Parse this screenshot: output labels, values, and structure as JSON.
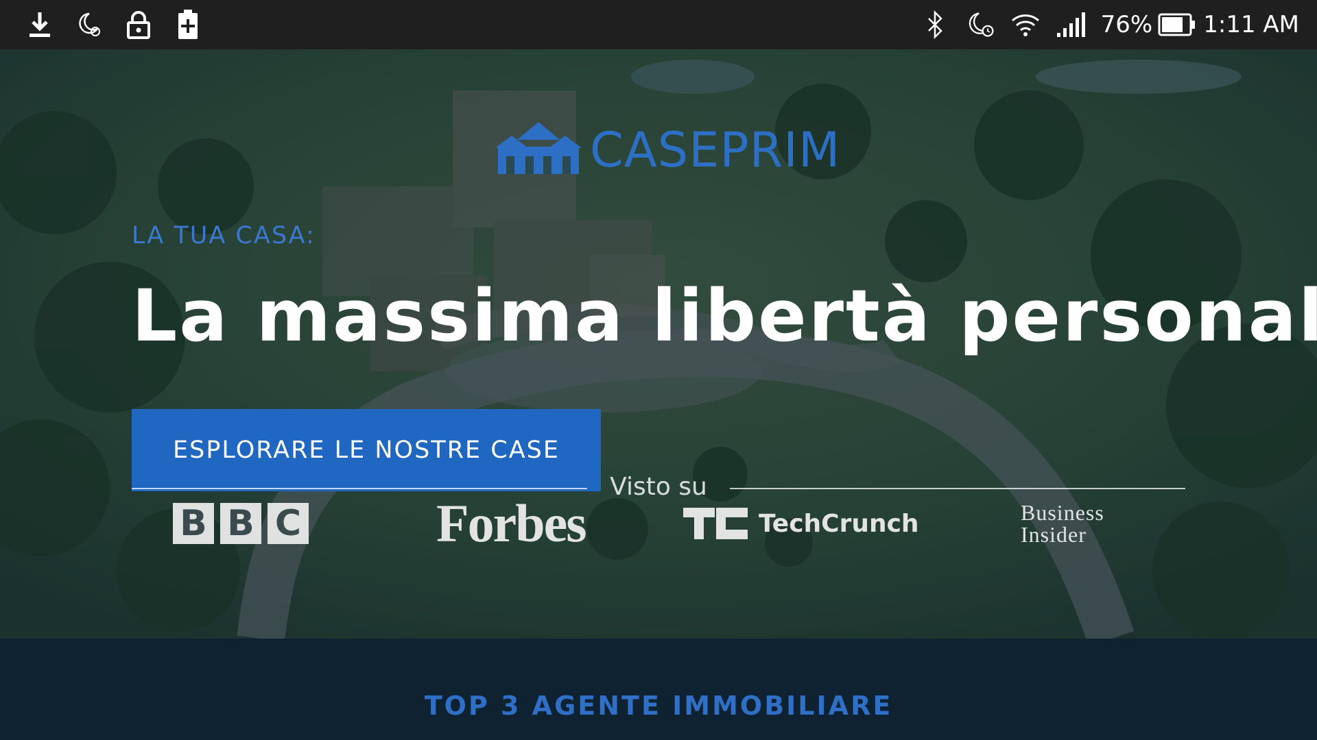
{
  "status_bar": {
    "left_icons": [
      "download-icon",
      "do-not-disturb-alarm-icon",
      "lock-icon",
      "battery-plus-icon"
    ],
    "right_icons": [
      "bluetooth-icon",
      "do-not-disturb-alarm-icon",
      "wifi-icon",
      "signal-icon",
      "battery-icon"
    ],
    "battery": "76%",
    "time": "1:11 AM"
  },
  "hero": {
    "logo": {
      "text": "CASEPRIM",
      "icon": "houses-logo-icon",
      "color": "#2e6fc6"
    },
    "eyebrow": "LA TUA CASA:",
    "headline": "La massima libertà personale",
    "cta_label": "ESPLORARE LE NOSTRE CASE",
    "cta_color": "#1f67c1",
    "seen_on_label": "Visto su",
    "press": [
      {
        "name": "BBC",
        "letters": [
          "B",
          "B",
          "C"
        ]
      },
      {
        "name": "Forbes"
      },
      {
        "name": "TechCrunch",
        "mark": "TC"
      },
      {
        "name": "Business Insider",
        "lines": [
          "Business",
          "Insider"
        ]
      }
    ]
  },
  "band": {
    "title": "TOP 3 AGENTE IMMOBILIARE",
    "background": "#0f2232"
  }
}
